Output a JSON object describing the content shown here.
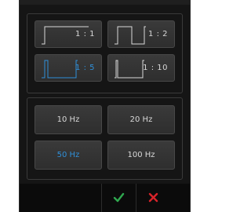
{
  "duty_cycle": {
    "options": [
      {
        "label": "1 : 1",
        "icon": "square-wave-1-1-icon"
      },
      {
        "label": "1 : 2",
        "icon": "square-wave-1-2-icon"
      },
      {
        "label": "1 : 5",
        "icon": "square-wave-1-5-icon"
      },
      {
        "label": "1 : 10",
        "icon": "square-wave-1-10-icon"
      }
    ],
    "selected": "1 : 5"
  },
  "frequency": {
    "options": [
      {
        "label": "10 Hz"
      },
      {
        "label": "20 Hz"
      },
      {
        "label": "50 Hz"
      },
      {
        "label": "100 Hz"
      }
    ],
    "selected": "50 Hz"
  },
  "footer": {
    "confirm_icon": "checkmark-icon",
    "cancel_icon": "close-icon"
  },
  "colors": {
    "selected": "#2f8fd8",
    "text": "#d8d8d8",
    "confirm": "#2fa84f",
    "cancel": "#d8232a",
    "background": "#151515"
  }
}
